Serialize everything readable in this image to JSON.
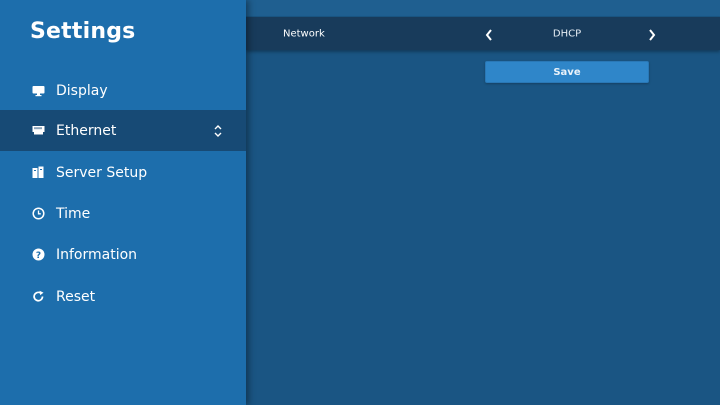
{
  "sidebar": {
    "title": "Settings",
    "items": [
      {
        "label": "Display",
        "icon": "monitor-icon"
      },
      {
        "label": "Ethernet",
        "icon": "ethernet-icon",
        "active": true
      },
      {
        "label": "Server Setup",
        "icon": "server-icon"
      },
      {
        "label": "Time",
        "icon": "clock-icon"
      },
      {
        "label": "Information",
        "icon": "help-circle-icon"
      },
      {
        "label": "Reset",
        "icon": "refresh-icon"
      }
    ]
  },
  "main": {
    "network_row": {
      "label": "Network",
      "value": "DHCP"
    },
    "save_label": "Save"
  },
  "colors": {
    "background": "#1a5583",
    "sidebar": "#1d6eac",
    "active_item": "#174a75",
    "row_bg": "#183b5b",
    "button": "#2f86c9"
  }
}
